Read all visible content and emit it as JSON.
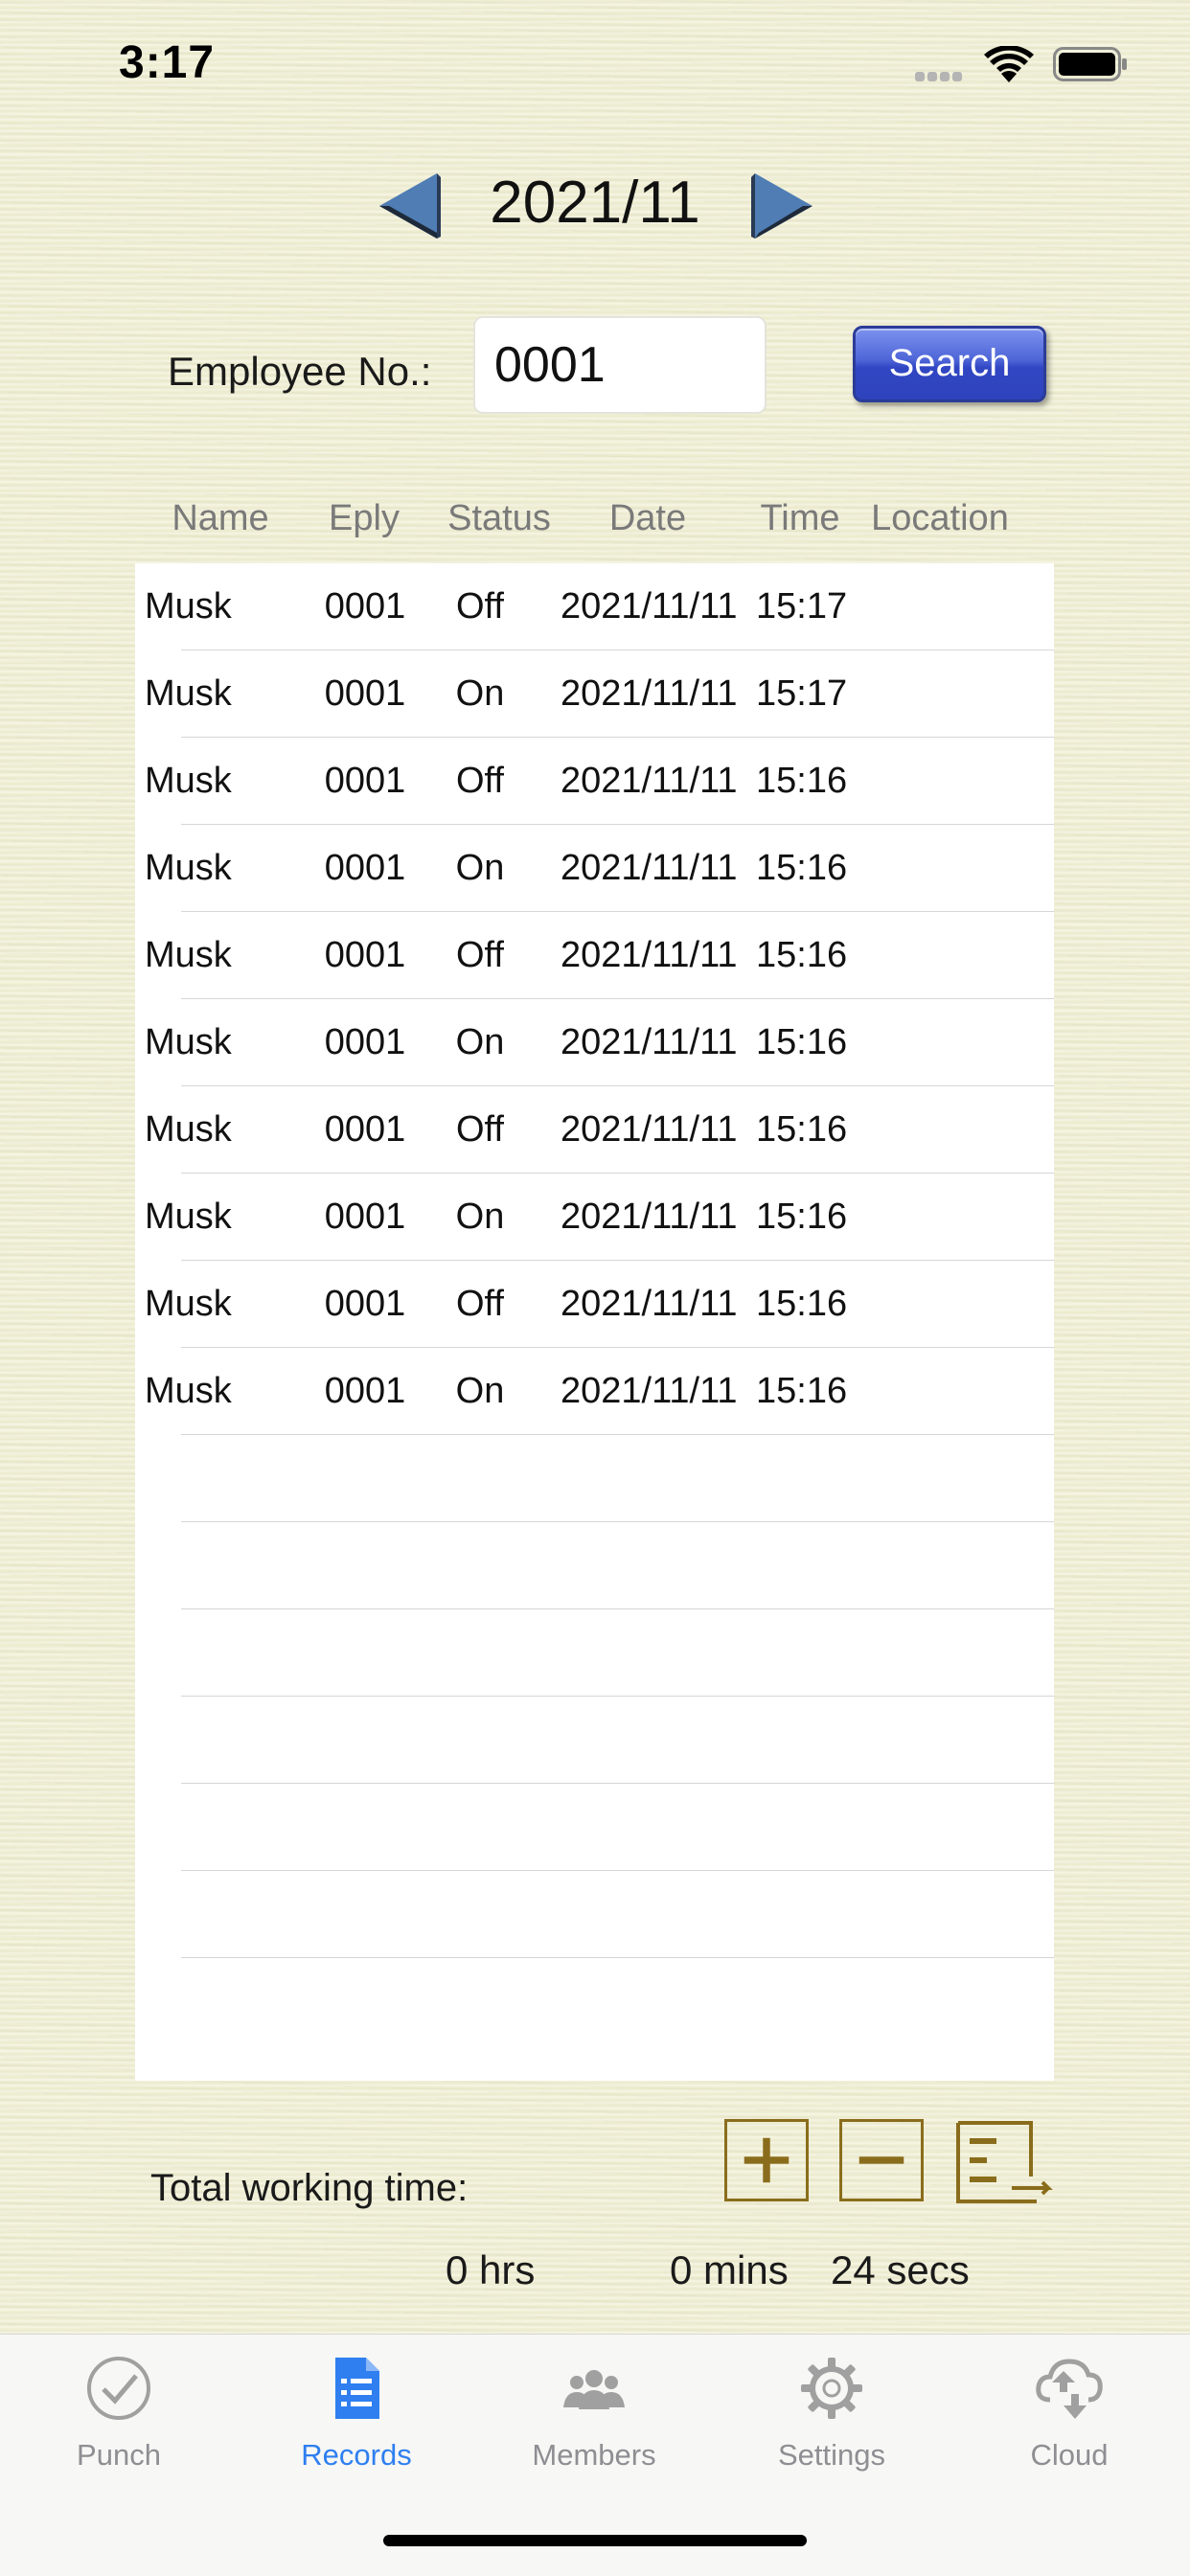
{
  "status_bar": {
    "time": "3:17"
  },
  "month_nav": {
    "month": "2021/11",
    "prev_icon": "triangle-left-icon",
    "next_icon": "triangle-right-icon"
  },
  "search": {
    "label": "Employee No.:",
    "value": "0001",
    "button_label": "Search"
  },
  "table": {
    "headers": [
      "Name",
      "Eply",
      "Status",
      "Date",
      "Time",
      "Location"
    ],
    "rows": [
      {
        "name": "Musk",
        "eply": "0001",
        "status": "Off",
        "date": "2021/11/11",
        "time": "15:17",
        "location": ""
      },
      {
        "name": "Musk",
        "eply": "0001",
        "status": "On",
        "date": "2021/11/11",
        "time": "15:17",
        "location": ""
      },
      {
        "name": "Musk",
        "eply": "0001",
        "status": "Off",
        "date": "2021/11/11",
        "time": "15:16",
        "location": ""
      },
      {
        "name": "Musk",
        "eply": "0001",
        "status": "On",
        "date": "2021/11/11",
        "time": "15:16",
        "location": ""
      },
      {
        "name": "Musk",
        "eply": "0001",
        "status": "Off",
        "date": "2021/11/11",
        "time": "15:16",
        "location": ""
      },
      {
        "name": "Musk",
        "eply": "0001",
        "status": "On",
        "date": "2021/11/11",
        "time": "15:16",
        "location": ""
      },
      {
        "name": "Musk",
        "eply": "0001",
        "status": "Off",
        "date": "2021/11/11",
        "time": "15:16",
        "location": ""
      },
      {
        "name": "Musk",
        "eply": "0001",
        "status": "On",
        "date": "2021/11/11",
        "time": "15:16",
        "location": ""
      },
      {
        "name": "Musk",
        "eply": "0001",
        "status": "Off",
        "date": "2021/11/11",
        "time": "15:16",
        "location": ""
      },
      {
        "name": "Musk",
        "eply": "0001",
        "status": "On",
        "date": "2021/11/11",
        "time": "15:16",
        "location": ""
      },
      {
        "name": "",
        "eply": "",
        "status": "",
        "date": "",
        "time": "",
        "location": ""
      },
      {
        "name": "",
        "eply": "",
        "status": "",
        "date": "",
        "time": "",
        "location": ""
      },
      {
        "name": "",
        "eply": "",
        "status": "",
        "date": "",
        "time": "",
        "location": ""
      },
      {
        "name": "",
        "eply": "",
        "status": "",
        "date": "",
        "time": "",
        "location": ""
      },
      {
        "name": "",
        "eply": "",
        "status": "",
        "date": "",
        "time": "",
        "location": ""
      },
      {
        "name": "",
        "eply": "",
        "status": "",
        "date": "",
        "time": "",
        "location": ""
      },
      {
        "name": "",
        "eply": "",
        "status": "",
        "date": "",
        "time": "",
        "location": ""
      }
    ]
  },
  "totals": {
    "label": "Total working time:",
    "hrs": "0 hrs",
    "mins": "0 mins",
    "secs": "24 secs"
  },
  "actions": {
    "add_icon": "plus-icon",
    "remove_icon": "minus-icon",
    "summary_icon": "list-summary-icon"
  },
  "tabs": [
    {
      "label": "Punch",
      "icon": "check-circle-icon",
      "active": false
    },
    {
      "label": "Records",
      "icon": "document-list-icon",
      "active": true
    },
    {
      "label": "Members",
      "icon": "people-icon",
      "active": false
    },
    {
      "label": "Settings",
      "icon": "gear-icon",
      "active": false
    },
    {
      "label": "Cloud",
      "icon": "cloud-sync-icon",
      "active": false
    }
  ],
  "colors": {
    "background": "#f1f0d6",
    "accent": "#2f7ff0",
    "arrow": "#4f7db4",
    "search_button": "#3b52c8",
    "action_icon": "#8a6d1c",
    "tab_inactive": "#8e8e93"
  }
}
